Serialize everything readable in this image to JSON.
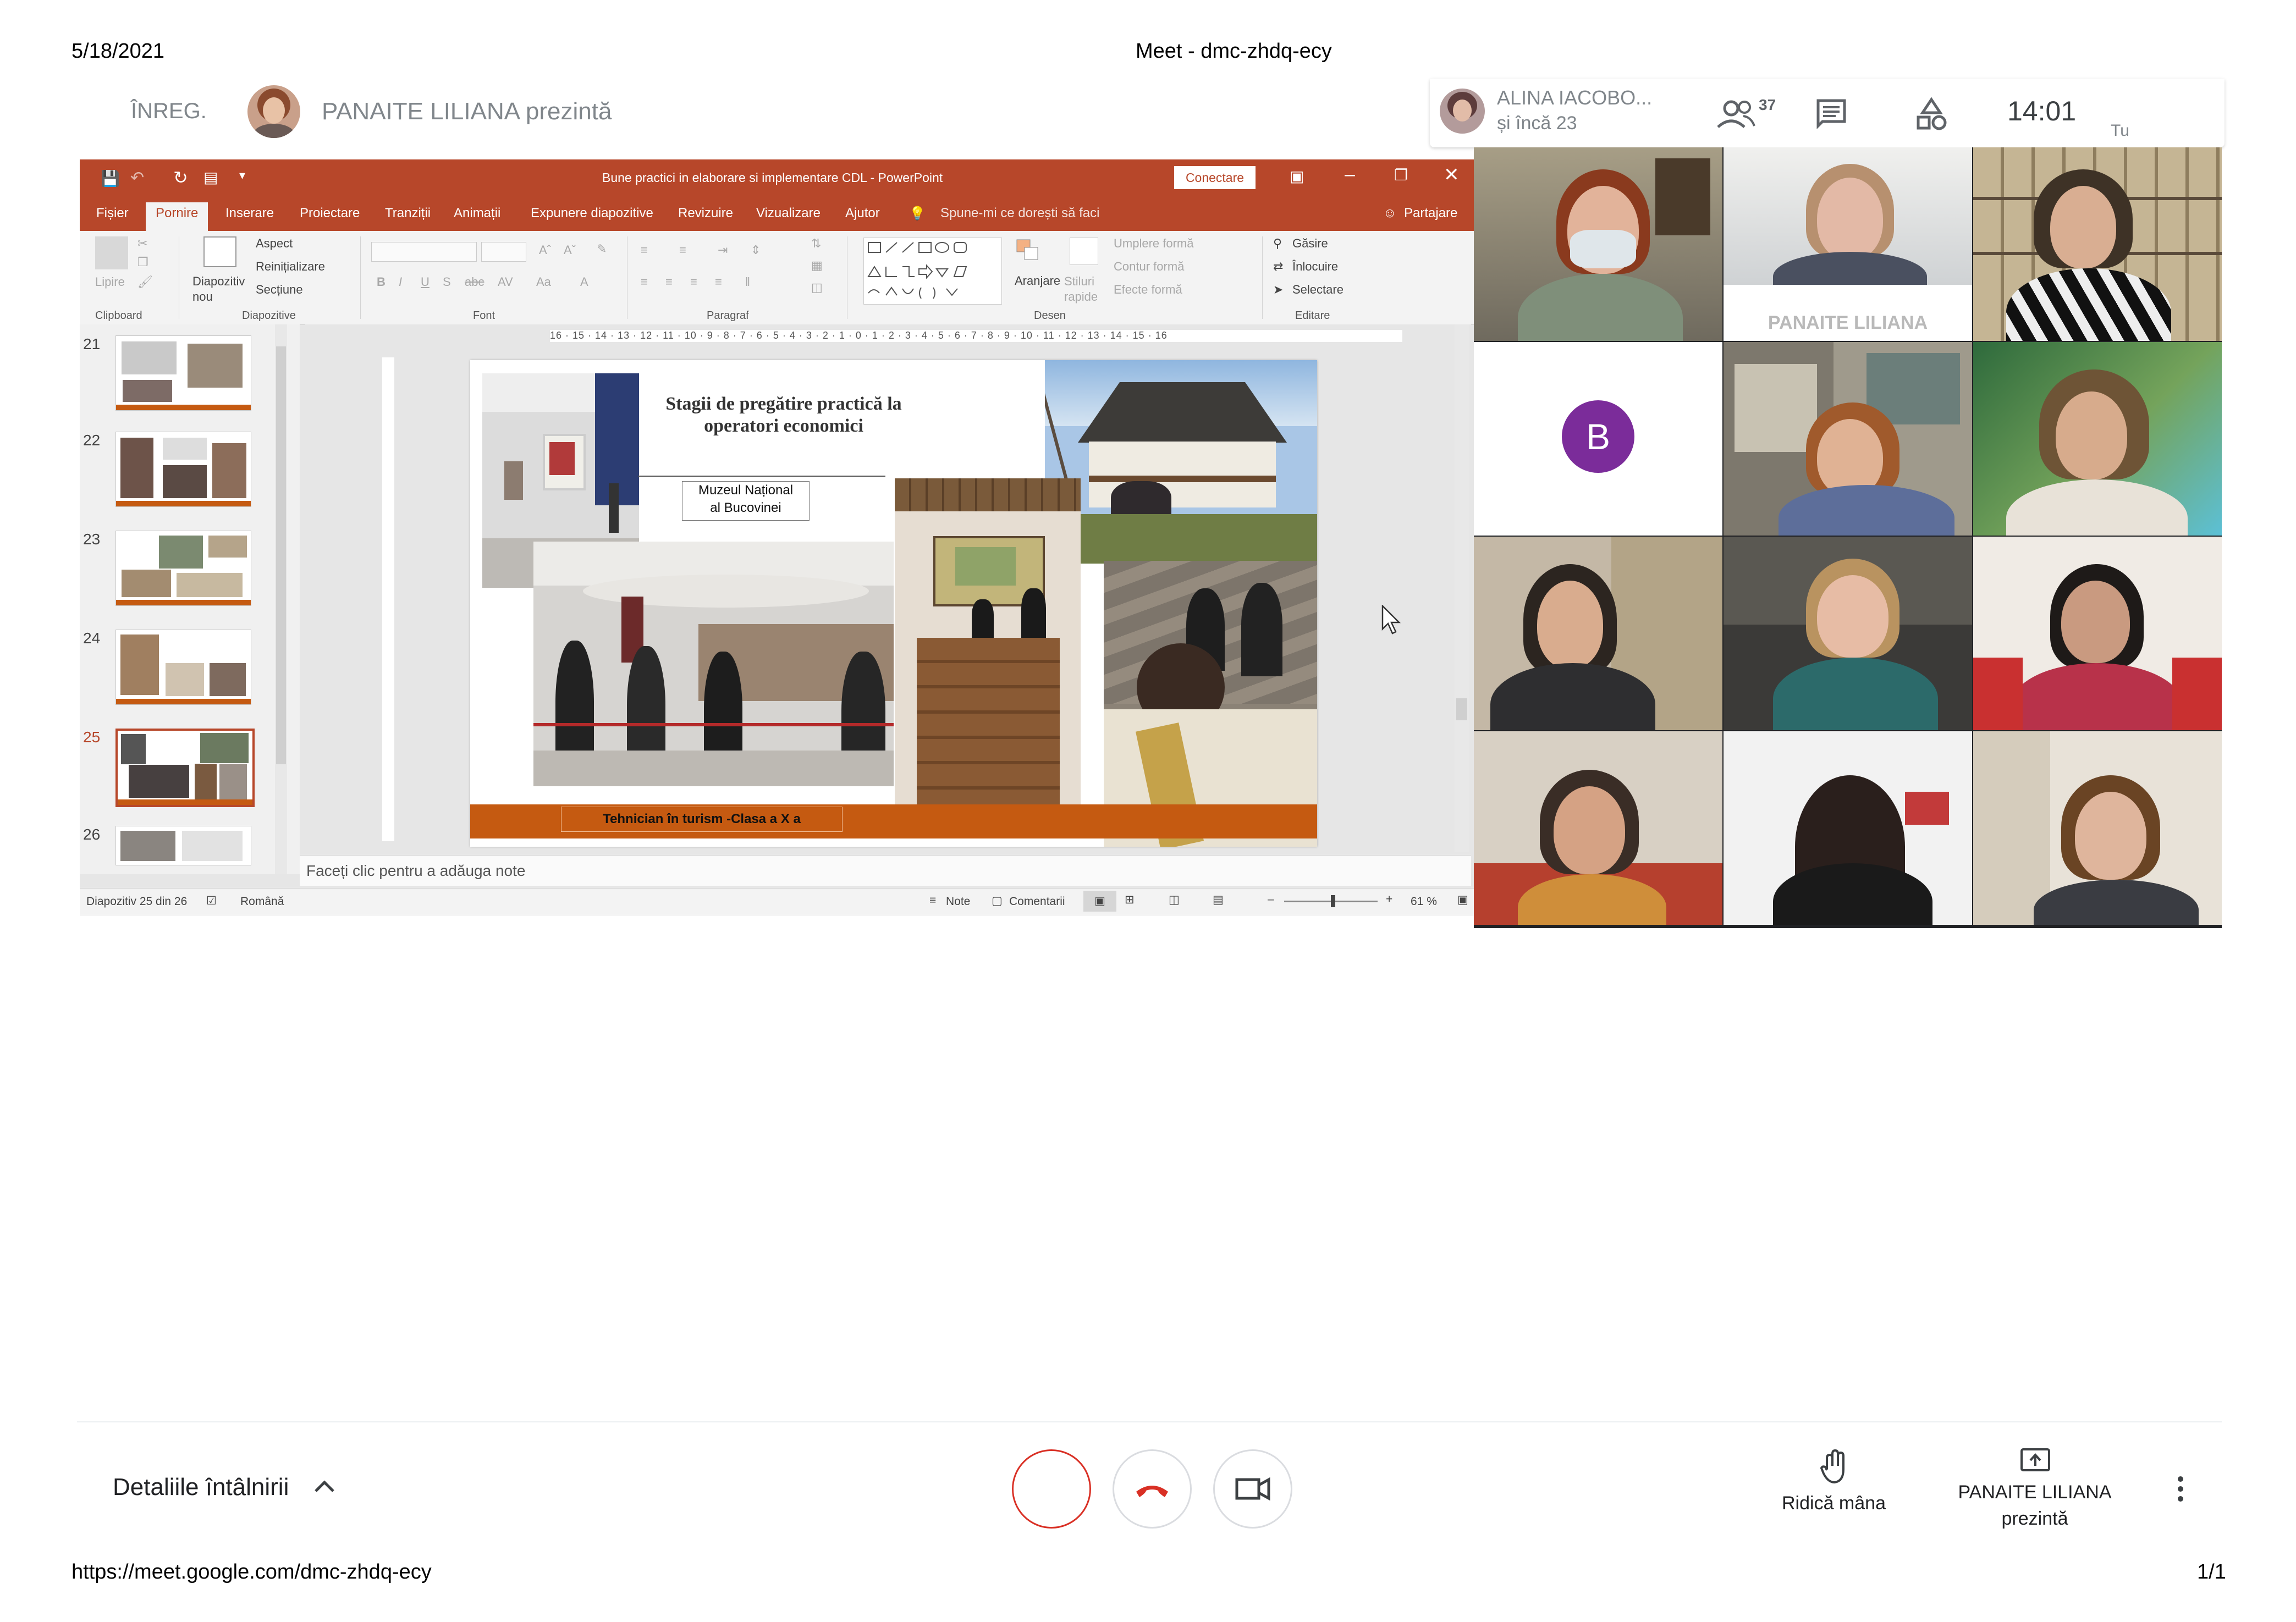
{
  "print_header": {
    "date": "5/18/2021",
    "title": "Meet - dmc-zhdq-ecy"
  },
  "print_footer": {
    "url": "https://meet.google.com/dmc-zhdq-ecy",
    "page": "1/1"
  },
  "meet_top": {
    "recording_label": "ÎNREG.",
    "presenter_text": "PANAITE LILIANA prezintă",
    "participant_name": "ALINA IACOBO...",
    "participant_more": "și încă 23",
    "participants_count": "37",
    "clock": "14:01",
    "self_label": "Tu"
  },
  "powerpoint": {
    "window_title": "Bune practici in elaborare si implementare CDL  -  PowerPoint",
    "connect_button": "Conectare",
    "tabs": [
      "Fișier",
      "Pornire",
      "Inserare",
      "Proiectare",
      "Tranziții",
      "Animații",
      "Expunere diapozitive",
      "Revizuire",
      "Vizualizare",
      "Ajutor"
    ],
    "active_tab": "Pornire",
    "tell_me": "Spune-mi ce dorești să faci",
    "share": "Partajare",
    "ribbon": {
      "paste": "Lipire",
      "new_slide": "Diapozitiv nou",
      "layout": "Aspect",
      "reset": "Reinițializare",
      "section": "Secțiune",
      "arrange": "Aranjare",
      "quick_styles": "Stiluri rapide",
      "shape_fill": "Umplere formă",
      "shape_outline": "Contur formă",
      "shape_effects": "Efecte formă",
      "find": "Găsire",
      "replace": "Înlocuire",
      "select": "Selectare",
      "groups": [
        "Clipboard",
        "Diapozitive",
        "Font",
        "Paragraf",
        "Desen",
        "Editare"
      ]
    },
    "thumb_numbers": [
      "21",
      "22",
      "23",
      "24",
      "25",
      "26"
    ],
    "selected_slide": "25",
    "ruler": "16 · 15 · 14 · 13 · 12 · 11 · 10 · 9 · 8 · 7 · 6 · 5 · 4 · 3 · 2 · 1 · 0 · 1 · 2 · 3 · 4 · 5 · 6 · 7 · 8 · 9 · 10 · 11 · 12 · 13 · 14 · 15 · 16",
    "slide": {
      "title_line1": "Stagii de pregătire practică la",
      "title_line2": "operatori  economici",
      "museum_line1": "Muzeul Național",
      "museum_line2": "al Bucovinei",
      "footer": "Tehnician în turism   -Clasa a X a"
    },
    "notes_placeholder": "Faceți clic pentru a adăuga note",
    "status": {
      "slide_count": "Diapozitiv 25 din 26",
      "language": "Română",
      "notes": "Note",
      "comments": "Comentarii",
      "zoom": "61 %"
    }
  },
  "tiles": {
    "name_label": "PANAITE LILIANA",
    "avatar_letter": "B",
    "avatar_color": "#7b2c9a"
  },
  "meet_bottom": {
    "meeting_details": "Detaliile întâlnirii",
    "raise_hand": "Ridică mâna",
    "presenting_line1": "PANAITE LILIANA",
    "presenting_line2": "prezintă"
  },
  "colors": {
    "ppt_accent": "#b7472a",
    "end_call": "#d93025",
    "slide_orange": "#c55a11"
  }
}
